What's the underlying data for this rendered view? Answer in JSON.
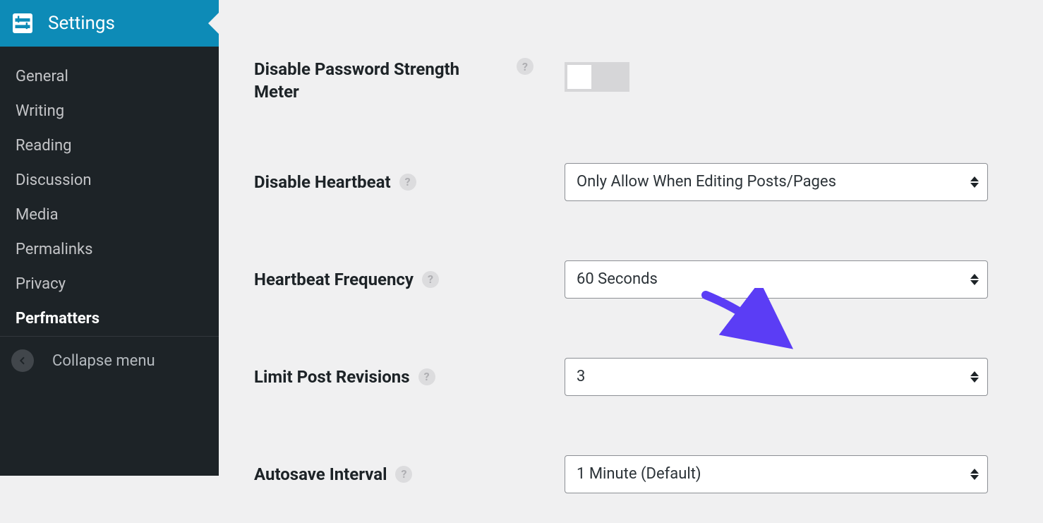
{
  "sidebar": {
    "top_label": "Settings",
    "items": [
      {
        "label": "General"
      },
      {
        "label": "Writing"
      },
      {
        "label": "Reading"
      },
      {
        "label": "Discussion"
      },
      {
        "label": "Media"
      },
      {
        "label": "Permalinks"
      },
      {
        "label": "Privacy"
      },
      {
        "label": "Perfmatters",
        "active": true
      }
    ],
    "collapse_label": "Collapse menu"
  },
  "settings": {
    "password_strength": {
      "label": "Disable Password Strength Meter",
      "toggle_on": false
    },
    "disable_heartbeat": {
      "label": "Disable Heartbeat",
      "value": "Only Allow When Editing Posts/Pages"
    },
    "heartbeat_frequency": {
      "label": "Heartbeat Frequency",
      "value": "60 Seconds"
    },
    "limit_post_revisions": {
      "label": "Limit Post Revisions",
      "value": "3"
    },
    "autosave_interval": {
      "label": "Autosave Interval",
      "value": "1 Minute (Default)"
    }
  },
  "help_glyph": "?"
}
